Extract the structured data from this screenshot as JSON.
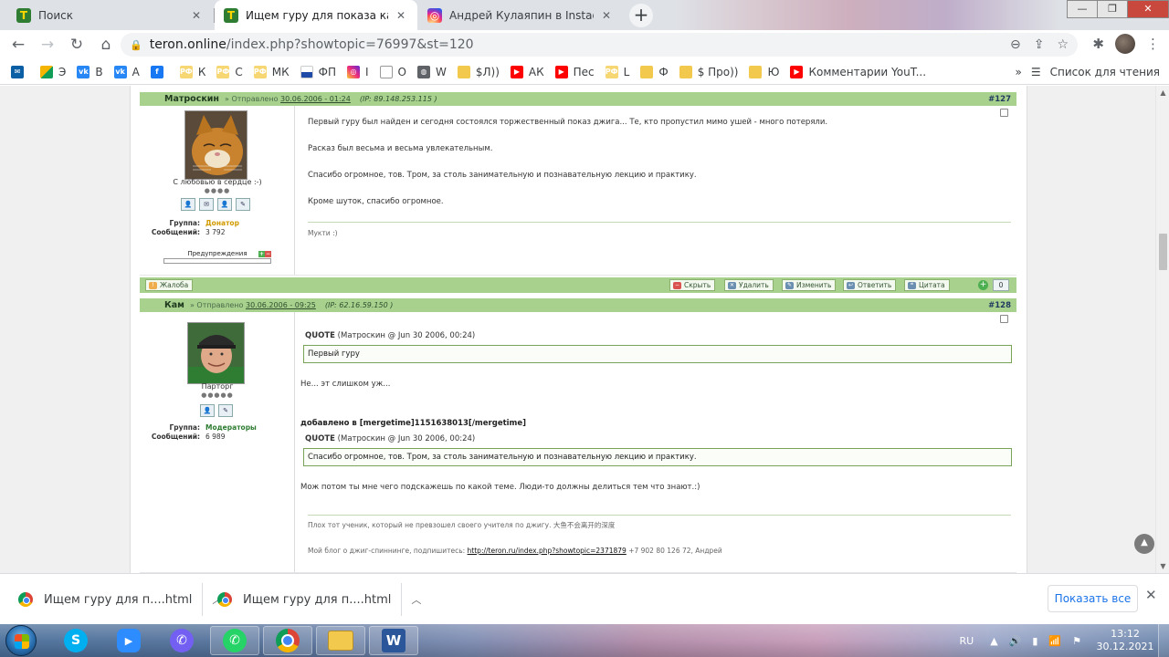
{
  "browser": {
    "tabs": [
      {
        "title": "Поиск",
        "favicon": "T",
        "active": false
      },
      {
        "title": "Ищем гуру для показа как ловя",
        "favicon": "T",
        "active": true
      },
      {
        "title": "Андрей Кулаяпин в Instagram: «С",
        "favicon": "instagram",
        "active": false
      }
    ],
    "new_tab": "+",
    "window_controls": {
      "minimize": "—",
      "maximize": "❐",
      "close": "✕"
    },
    "url_host": "teron.online",
    "url_path": "/index.php?showtopic=76997&st=120",
    "bookmarks": [
      {
        "label": "",
        "icon": "mail-icon"
      },
      {
        "label": "Э",
        "icon": "grid-icon"
      },
      {
        "label": "В",
        "icon": "vk-icon"
      },
      {
        "label": "А",
        "icon": "vk-icon"
      },
      {
        "label": "",
        "icon": "facebook-icon"
      },
      {
        "label": "К",
        "icon": "rf-icon"
      },
      {
        "label": "С",
        "icon": "rf-icon"
      },
      {
        "label": "МК",
        "icon": "rf-icon"
      },
      {
        "label": "ФП",
        "icon": "chart-icon"
      },
      {
        "label": "I",
        "icon": "instagram-icon"
      },
      {
        "label": "О",
        "icon": "walk-icon"
      },
      {
        "label": "W",
        "icon": "globe-icon"
      },
      {
        "label": "$Л))",
        "icon": "folder-icon"
      },
      {
        "label": "АК",
        "icon": "youtube-icon"
      },
      {
        "label": "Пес",
        "icon": "youtube-icon"
      },
      {
        "label": "L",
        "icon": "rf-icon"
      },
      {
        "label": "Ф",
        "icon": "folder-icon"
      },
      {
        "label": "$ Про))",
        "icon": "folder-icon"
      },
      {
        "label": "Ю",
        "icon": "folder-icon"
      },
      {
        "label": "Комментарии YouT...",
        "icon": "youtube-icon"
      }
    ],
    "bookmarks_more": "»",
    "reading_list": "Список для чтения"
  },
  "posts": [
    {
      "author": "Матроскин",
      "sent_label": "Отправлено",
      "date": "30.06.2006 - 01:24",
      "ip_label": "IP:",
      "ip": "89.148.253.115",
      "num": "#127",
      "user_caption": "С любовью в сердце :-)",
      "rank_dots": "●●●●",
      "group_label": "Группа:",
      "group": "Донатор",
      "posts_label": "Сообщений:",
      "posts_count": "3 792",
      "warn_label": "Предупреждения",
      "paragraphs": [
        "Первый гуру был найден и сегодня состоялся торжественный показ джига... Те, кто пропустил мимо ушей - много потеряли.",
        "Расказ был весьма и весьма увлекательным.",
        "Спасибо огромное, тов. Тром, за столь занимательную и познавательную лекцию и практику.",
        "Кроме шуток, спасибо огромное."
      ],
      "signature": "Мукти :)"
    },
    {
      "author": "Кам",
      "sent_label": "Отправлено",
      "date": "30.06.2006 - 09:25",
      "ip_label": "IP:",
      "ip": "62.16.59.150",
      "num": "#128",
      "user_caption": "Парторг",
      "rank_dots": "●●●●●",
      "group_label": "Группа:",
      "group": "Модераторы",
      "posts_label": "Сообщений:",
      "posts_count": "6 989",
      "quote1_label": "QUOTE",
      "quote1_src": "(Матроскин @ Jun 30 2006, 00:24)",
      "quote1_text": "Первый гуру",
      "reply1": "Не... эт слишком уж...",
      "merged": "добавлено в [mergetime]1151638013[/mergetime]",
      "quote2_label": "QUOTE",
      "quote2_src": "(Матроскин @ Jun 30 2006, 00:24)",
      "quote2_text": "Спасибо огромное, тов. Тром, за столь занимательную и познавательную лекцию и практику.",
      "reply2": "Мож потом ты мне чего подскажешь по какой теме. Люди-то должны делиться тем что знают.:)",
      "sig1": "Плох тот ученик, который не превзошел своего учителя по джигу. 大鱼不会离开的深度",
      "sig2_prefix": "Мой блог о джиг-спиннинге, подпишитесь:",
      "sig2_link": "http://teron.ru/index.php?showtopic=2371879",
      "sig2_suffix": "+7 902 80 126 72, Андрей"
    }
  ],
  "post_footer": {
    "complaint": "Жалоба",
    "hide": "Скрыть",
    "delete": "Удалить",
    "edit": "Изменить",
    "reply": "Ответить",
    "quote": "Цитата",
    "rep_plus": "+",
    "rep_count": "0"
  },
  "downloads": {
    "items": [
      "Ищем гуру для п....html",
      "Ищем гуру для п....html"
    ],
    "show_all": "Показать все",
    "close": "✕"
  },
  "taskbar": {
    "lang": "RU",
    "time": "13:12",
    "date": "30.12.2021",
    "word_letter": "W",
    "skype_letter": "S"
  }
}
